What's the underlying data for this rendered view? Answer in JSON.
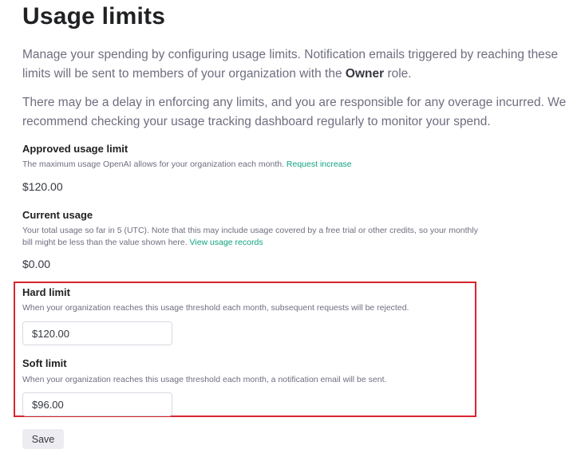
{
  "page": {
    "title": "Usage limits",
    "intro_1_before": "Manage your spending by configuring usage limits. Notification emails triggered by reaching these limits will be sent to members of your organization with the ",
    "intro_1_bold": "Owner",
    "intro_1_after": " role.",
    "intro_2": "There may be a delay in enforcing any limits, and you are responsible for any overage incurred. We recommend checking your usage tracking dashboard regularly to monitor your spend."
  },
  "approved": {
    "heading": "Approved usage limit",
    "description": "The maximum usage OpenAI allows for your organization each month. ",
    "link": "Request increase",
    "value": "$120.00"
  },
  "current": {
    "heading": "Current usage",
    "description": "Your total usage so far in 5 (UTC). Note that this may include usage covered by a free trial or other credits, so your monthly bill might be less than the value shown here. ",
    "link": "View usage records",
    "value": "$0.00"
  },
  "hard_limit": {
    "heading": "Hard limit",
    "description": "When your organization reaches this usage threshold each month, subsequent requests will be rejected.",
    "value": "$120.00"
  },
  "soft_limit": {
    "heading": "Soft limit",
    "description": "When your organization reaches this usage threshold each month, a notification email will be sent.",
    "value": "$96.00"
  },
  "actions": {
    "save_label": "Save"
  },
  "colors": {
    "link": "#10a37f",
    "highlight_border": "#d9252f",
    "button_bg": "#ececf1"
  }
}
